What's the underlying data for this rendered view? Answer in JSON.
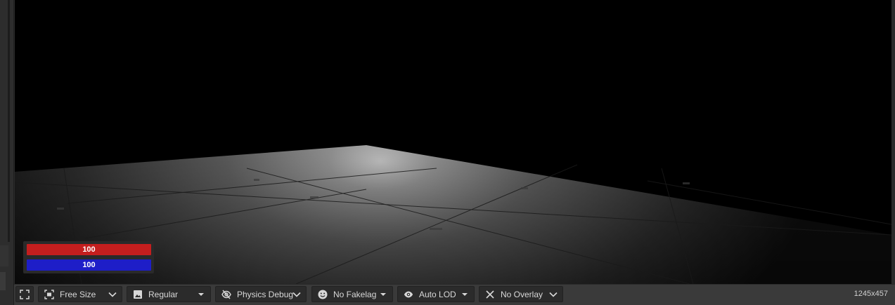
{
  "hud": {
    "health_value": "100",
    "armor_value": "100",
    "health_color": "#c41e1e",
    "armor_color": "#1e1ec8"
  },
  "toolbar": {
    "fullscreen_icon": "fullscreen-icon",
    "items": [
      {
        "label": "Free Size",
        "icon": "aspect-icon",
        "dropdown": "chevron-down-icon"
      },
      {
        "label": "Regular",
        "icon": "image-icon",
        "dropdown": "caret-down-icon"
      },
      {
        "label": "Physics Debug",
        "icon": "eye-off-icon",
        "dropdown": "chevron-down-icon"
      },
      {
        "label": "No Fakelag",
        "icon": "smiley-icon",
        "dropdown": "caret-down-icon"
      },
      {
        "label": "Auto LOD",
        "icon": "eye-icon",
        "dropdown": "caret-down-icon"
      },
      {
        "label": "No Overlay",
        "icon": "close-icon",
        "dropdown": "chevron-down-icon"
      }
    ],
    "resolution": "1245x457"
  }
}
